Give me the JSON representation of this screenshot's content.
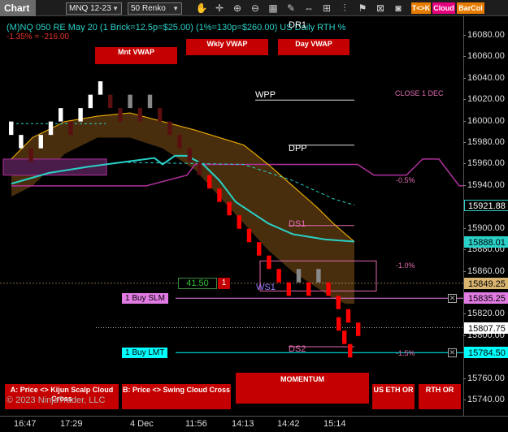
{
  "toolbar": {
    "title": "Chart",
    "instrument": "MNQ 12-23",
    "bar_type": "50 Renko",
    "buttons": [
      {
        "label": "T<>K",
        "color": "#e57c00"
      },
      {
        "label": "Cloud",
        "color": "#e4007d"
      },
      {
        "label": "BarCol",
        "color": "#e57c00"
      }
    ],
    "icons": [
      "hand-icon",
      "crosshair-icon",
      "zoom-in-icon",
      "zoom-out-icon",
      "properties-icon",
      "drawing-icon",
      "arrows-icon",
      "interval-icon",
      "indicators-icon",
      "strategy-icon",
      "chart-trader-icon",
      "camera-icon"
    ]
  },
  "header": {
    "line1": "(M)NQ 050 RE May 20 (1 Brick=12.5p=$25.00) (1%=130p=$260.00) US Daily RTH %",
    "line1_color": "#2ad1c8",
    "line2": "-1.35% = -216.00",
    "line2_color": "#e5332a"
  },
  "vwap_buttons": [
    "Mnt VWAP",
    "Wkly VWAP",
    "Day VWAP"
  ],
  "pivots": {
    "dr1": "DR1",
    "wpp": "WPP",
    "dpp": "DPP",
    "ds1": "DS1",
    "ws1": "WS1",
    "ds2": "DS2",
    "close_label": "CLOSE 1 DEC"
  },
  "percent_labels": [
    "-0.5%",
    "-1.0%",
    "-1.5%"
  ],
  "position": {
    "price": "41.50",
    "qty": "1"
  },
  "orders": [
    {
      "label": "1 Buy SLM",
      "price": "15835.25",
      "bg": "#e27be3",
      "color": "#000"
    },
    {
      "label": "1 Buy LMT",
      "price": "15784.50",
      "bg": "#00ffff",
      "color": "#000"
    }
  ],
  "price_axis": {
    "ticks": [
      "16080.00",
      "16060.00",
      "16040.00",
      "16020.00",
      "16000.00",
      "15980.00",
      "15960.00",
      "15940.00",
      "15900.00",
      "15880.00",
      "15860.00",
      "15820.00",
      "15800.00",
      "15760.00",
      "15740.00"
    ],
    "tags": [
      {
        "value": "15921.88",
        "bg": "#000",
        "color": "#fff",
        "border": "#2ad1c8"
      },
      {
        "value": "15888.01",
        "bg": "#2ad1c8",
        "color": "#000",
        "border": "#2ad1c8"
      },
      {
        "value": "15849.25",
        "bg": "#d9b56f",
        "color": "#000",
        "border": "#d9b56f"
      },
      {
        "value": "15835.25",
        "bg": "#e27be3",
        "color": "#000",
        "border": "#e27be3"
      },
      {
        "value": "15807.75",
        "bg": "#fff",
        "color": "#000",
        "border": "#fff"
      },
      {
        "value": "15784.50",
        "bg": "#00ffff",
        "color": "#000",
        "border": "#00ffff"
      }
    ]
  },
  "time_axis": [
    "16:47",
    "17:29",
    "4 Dec",
    "11:56",
    "14:13",
    "14:42",
    "15:14"
  ],
  "bottom_buttons": [
    {
      "label": "A: Price <> Kijun Scalp Cloud Cross"
    },
    {
      "label": "B: Price <> Swing Cloud Cross"
    },
    {
      "label": "MOMENTUM"
    },
    {
      "label": "US ETH OR"
    },
    {
      "label": "RTH OR"
    }
  ],
  "copyright": "© 2023 NinjaTrader, LLC",
  "colors": {
    "up_brick": "#ffffff",
    "down_brick": "#ff0000",
    "kijun": "#2ad1c8",
    "cloud": "#5a3a10",
    "swing": "#e5a800",
    "monthly_vwap": "#b1309c",
    "background": "#000000"
  },
  "chart_data": {
    "type": "renko",
    "brick_size": 12.5,
    "y_unit": "price",
    "ylim": [
      15730,
      16095
    ],
    "bricks": [
      {
        "dir": "up",
        "low": 15987.5,
        "high": 16000
      },
      {
        "dir": "up",
        "low": 15975,
        "high": 15987.5
      },
      {
        "dir": "down",
        "low": 15962.5,
        "high": 15975
      },
      {
        "dir": "up",
        "low": 15975,
        "high": 15987.5
      },
      {
        "dir": "up",
        "low": 15987.5,
        "high": 16000
      },
      {
        "dir": "up",
        "low": 16000,
        "high": 16012.5
      },
      {
        "dir": "down",
        "low": 15987.5,
        "high": 16000
      },
      {
        "dir": "up",
        "low": 16000,
        "high": 16012.5
      },
      {
        "dir": "up",
        "low": 16012.5,
        "high": 16025
      },
      {
        "dir": "up",
        "low": 16025,
        "high": 16037.5
      },
      {
        "dir": "down",
        "low": 16012.5,
        "high": 16025
      },
      {
        "dir": "down",
        "low": 16000,
        "high": 16012.5
      },
      {
        "dir": "up",
        "low": 16012.5,
        "high": 16025
      },
      {
        "dir": "down",
        "low": 16000,
        "high": 16012.5
      },
      {
        "dir": "up",
        "low": 16012.5,
        "high": 16025
      },
      {
        "dir": "down",
        "low": 16000,
        "high": 16012.5
      },
      {
        "dir": "down",
        "low": 15987.5,
        "high": 16000
      },
      {
        "dir": "down",
        "low": 15975,
        "high": 15987.5
      },
      {
        "dir": "down",
        "low": 15962.5,
        "high": 15975
      },
      {
        "dir": "down",
        "low": 15950,
        "high": 15962.5
      },
      {
        "dir": "down",
        "low": 15937.5,
        "high": 15950
      },
      {
        "dir": "down",
        "low": 15925,
        "high": 15937.5
      },
      {
        "dir": "down",
        "low": 15912.5,
        "high": 15925
      },
      {
        "dir": "down",
        "low": 15900,
        "high": 15912.5
      },
      {
        "dir": "down",
        "low": 15887.5,
        "high": 15900
      },
      {
        "dir": "down",
        "low": 15875,
        "high": 15887.5
      },
      {
        "dir": "down",
        "low": 15862.5,
        "high": 15875
      },
      {
        "dir": "down",
        "low": 15850,
        "high": 15862.5
      },
      {
        "dir": "down",
        "low": 15837.5,
        "high": 15850
      },
      {
        "dir": "up",
        "low": 15850,
        "high": 15862.5
      },
      {
        "dir": "down",
        "low": 15837.5,
        "high": 15850
      },
      {
        "dir": "up",
        "low": 15850,
        "high": 15862.5
      },
      {
        "dir": "down",
        "low": 15837.5,
        "high": 15850
      },
      {
        "dir": "down",
        "low": 15825,
        "high": 15837.5
      },
      {
        "dir": "down",
        "low": 15812.5,
        "high": 15825
      },
      {
        "dir": "down",
        "low": 15800,
        "high": 15812.5
      }
    ],
    "kijun": [
      15955,
      15958,
      15960,
      15962,
      15965,
      15964,
      15962,
      15958,
      15948,
      15935,
      15925,
      15915,
      15905,
      15897,
      15890,
      15888
    ],
    "swing_upper": [
      15965,
      15985,
      16000,
      16005,
      16008,
      16000,
      15992,
      15985,
      15978,
      15960,
      15940,
      15920,
      15905,
      15895,
      15888
    ],
    "monthly_vwap": [
      15940,
      15940,
      15950,
      15960,
      15960,
      15960,
      15950,
      15950,
      15950,
      15965,
      15965,
      15940,
      15940
    ],
    "horizontal_levels": [
      {
        "name": "WPP",
        "value": 16020
      },
      {
        "name": "DPP",
        "value": 15978
      },
      {
        "name": "DS1",
        "value": 15903
      },
      {
        "name": "DS2",
        "value": 15790
      }
    ]
  }
}
